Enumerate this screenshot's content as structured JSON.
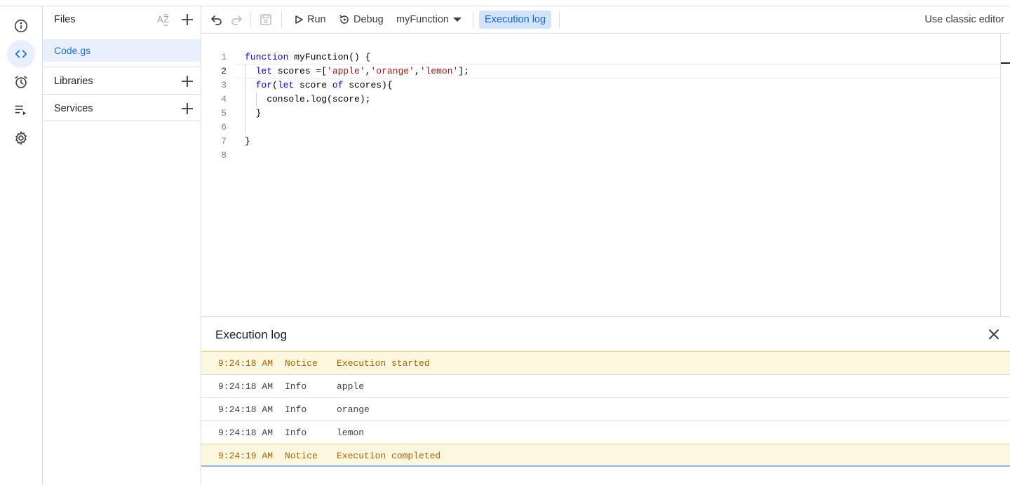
{
  "files_panel": {
    "title": "Files",
    "files": [
      {
        "name": "Code.gs"
      }
    ],
    "sections": [
      {
        "label": "Libraries"
      },
      {
        "label": "Services"
      }
    ]
  },
  "rail": {
    "items": [
      {
        "name": "overview",
        "icon": "info-icon"
      },
      {
        "name": "editor",
        "icon": "code-icon",
        "active": true
      },
      {
        "name": "triggers",
        "icon": "alarm-icon"
      },
      {
        "name": "executions",
        "icon": "executions-list-icon"
      },
      {
        "name": "settings",
        "icon": "gear-icon"
      }
    ]
  },
  "toolbar": {
    "run_label": "Run",
    "debug_label": "Debug",
    "function_select": "myFunction",
    "execution_log_label": "Execution log",
    "classic_editor_label": "Use classic editor"
  },
  "editor": {
    "current_line": 2,
    "lines": [
      {
        "n": "1",
        "code": "function myFunction() {"
      },
      {
        "n": "2",
        "code": "  let scores =['apple','orange','lemon'];"
      },
      {
        "n": "3",
        "code": "  for(let score of scores){"
      },
      {
        "n": "4",
        "code": "    console.log(score);"
      },
      {
        "n": "5",
        "code": "  }"
      },
      {
        "n": "6",
        "code": ""
      },
      {
        "n": "7",
        "code": "}"
      },
      {
        "n": "8",
        "code": ""
      }
    ]
  },
  "execution_log": {
    "title": "Execution log",
    "entries": [
      {
        "time": "9:24:18 AM",
        "type": "Notice",
        "message": "Execution started"
      },
      {
        "time": "9:24:18 AM",
        "type": "Info",
        "message": "apple"
      },
      {
        "time": "9:24:18 AM",
        "type": "Info",
        "message": "orange"
      },
      {
        "time": "9:24:18 AM",
        "type": "Info",
        "message": "lemon"
      },
      {
        "time": "9:24:19 AM",
        "type": "Notice",
        "message": "Execution completed"
      }
    ]
  },
  "colors": {
    "accent": "#1a73e8",
    "selected_bg": "#e8f0fe",
    "notice_bg": "#fef7e0",
    "notice_text": "#b06000"
  }
}
